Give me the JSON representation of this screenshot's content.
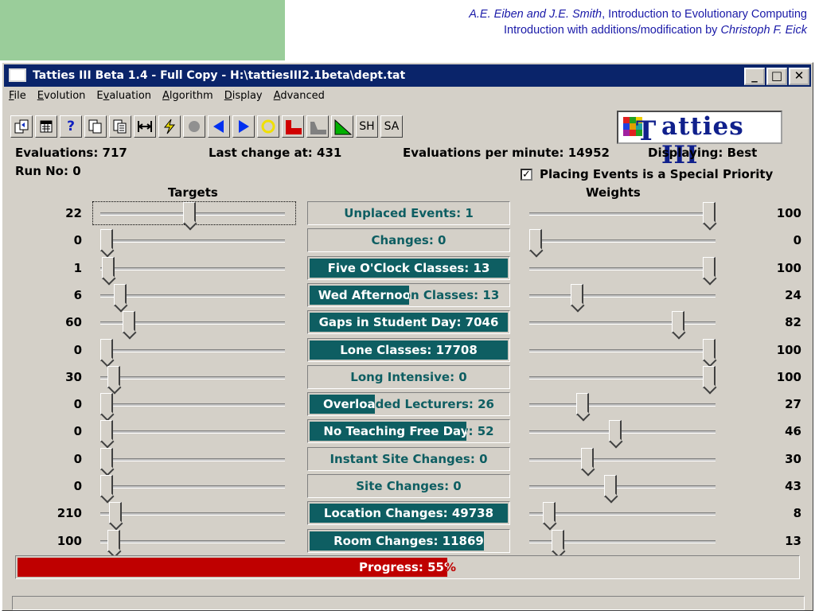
{
  "slide": {
    "caption_authors": "A.E. Eiben and J.E. Smith",
    "caption_title": ", Introduction to Evolutionary Computing",
    "caption_line2_prefix": "Introduction with additions/modification by ",
    "caption_line2_author": "Christoph F. Eick"
  },
  "window": {
    "title": "Tatties III Beta 1.4 - Full Copy - H:\\tattiesIII2.1beta\\dept.tat",
    "minimize": "_",
    "maximize": "□",
    "close": "✕"
  },
  "menu": [
    {
      "label": "File",
      "key": "F",
      "rest": "ile"
    },
    {
      "label": "Evolution",
      "key": "E",
      "rest": "volution"
    },
    {
      "label": "Evaluation",
      "key": "v",
      "pre": "E",
      "rest": "aluation"
    },
    {
      "label": "Algorithm",
      "key": "A",
      "rest": "lgorithm"
    },
    {
      "label": "Display",
      "key": "D",
      "rest": "isplay"
    },
    {
      "label": "Advanced",
      "key": "A",
      "rest": "dvanced"
    }
  ],
  "toolbar": {
    "icons": [
      "open-icon",
      "calendar-icon",
      "help-icon",
      "copy-icon",
      "paste-icon",
      "fit-width-icon",
      "lightning-icon",
      "stop-icon",
      "back-icon",
      "forward-icon",
      "circle-icon",
      "red-graph-icon",
      "gray-graph-icon",
      "green-graph-icon"
    ],
    "sh_label": "SH",
    "sa_label": "SA"
  },
  "logo": {
    "text": "atties III",
    "letter": "T"
  },
  "stats": {
    "evaluations": "Evaluations: 717",
    "last_change": "Last change at: 431",
    "evals_per_minute": "Evaluations per minute: 14952",
    "displaying": "Displaying: Best",
    "run_no": "Run No: 0",
    "placing_priority": "Placing Events is a Special Priority",
    "placing_checked": "✓"
  },
  "headers": {
    "targets": "Targets",
    "weights": "Weights"
  },
  "rows": [
    {
      "target": "22",
      "target_pos": 0.48,
      "label": "Unplaced Events: 1",
      "fill": 0.0,
      "weight": "100",
      "weight_pos": 1.0
    },
    {
      "target": "0",
      "target_pos": 0.0,
      "label": "Changes: 0",
      "fill": 0.0,
      "weight": "0",
      "weight_pos": 0.0
    },
    {
      "target": "1",
      "target_pos": 0.01,
      "label": "Five O'Clock Classes: 13",
      "fill": 1.0,
      "weight": "100",
      "weight_pos": 1.0
    },
    {
      "target": "6",
      "target_pos": 0.08,
      "label": "Wed Afternoon Classes: 13",
      "fill": 0.5,
      "weight": "24",
      "weight_pos": 0.24
    },
    {
      "target": "60",
      "target_pos": 0.13,
      "label": "Gaps in Student Day: 7046",
      "fill": 1.0,
      "weight": "82",
      "weight_pos": 0.82
    },
    {
      "target": "0",
      "target_pos": 0.0,
      "label": "Lone Classes: 17708",
      "fill": 1.0,
      "weight": "100",
      "weight_pos": 1.0
    },
    {
      "target": "30",
      "target_pos": 0.04,
      "label": "Long Intensive: 0",
      "fill": 0.0,
      "weight": "100",
      "weight_pos": 1.0
    },
    {
      "target": "0",
      "target_pos": 0.0,
      "label": "Overloaded Lecturers: 26",
      "fill": 0.33,
      "weight": "27",
      "weight_pos": 0.27
    },
    {
      "target": "0",
      "target_pos": 0.0,
      "label": "No Teaching Free Day: 52",
      "fill": 0.79,
      "weight": "46",
      "weight_pos": 0.46
    },
    {
      "target": "0",
      "target_pos": 0.0,
      "label": "Instant Site Changes: 0",
      "fill": 0.0,
      "weight": "30",
      "weight_pos": 0.3
    },
    {
      "target": "0",
      "target_pos": 0.0,
      "label": "Site Changes: 0",
      "fill": 0.0,
      "weight": "43",
      "weight_pos": 0.43
    },
    {
      "target": "210",
      "target_pos": 0.05,
      "label": "Location Changes: 49738",
      "fill": 1.0,
      "weight": "8",
      "weight_pos": 0.08
    },
    {
      "target": "100",
      "target_pos": 0.04,
      "label": "Room Changes: 11869",
      "fill": 0.88,
      "weight": "13",
      "weight_pos": 0.13
    }
  ],
  "progress": {
    "label": "Progress: 55%",
    "value": 0.55
  },
  "colors": {
    "bar_fill": "#0e5e62",
    "progress_fill": "#bf0000",
    "titlebar": "#0a246a",
    "face": "#d4d0c8"
  }
}
